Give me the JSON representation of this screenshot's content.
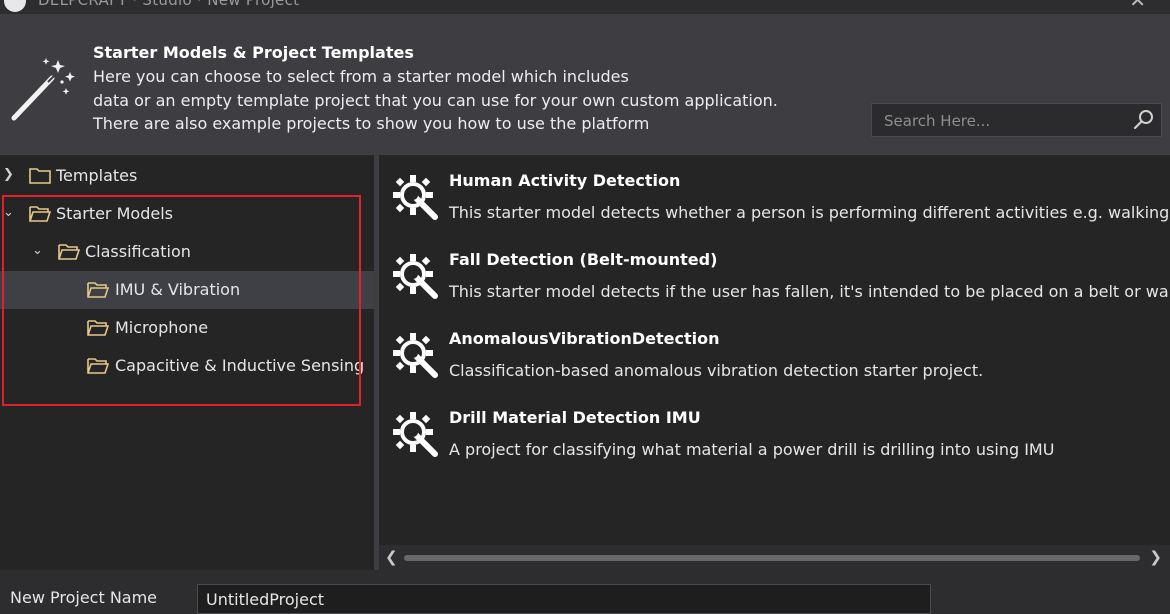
{
  "window": {
    "title": "DELPCRAFT · Studio · New Project",
    "close_glyph": "✕"
  },
  "header": {
    "title": "Starter Models & Project Templates",
    "lines": [
      "Here you can choose to select from a starter model which includes",
      "data or an empty template project that you can use for your own custom application.",
      "There are also example projects to show you how to use the platform"
    ],
    "icon": "magic-wand-icon"
  },
  "search": {
    "placeholder": "Search Here...",
    "value": ""
  },
  "tree": {
    "items": [
      {
        "label": "Templates",
        "level": 0,
        "expanded": false,
        "selected": false
      },
      {
        "label": "Starter Models",
        "level": 0,
        "expanded": true,
        "selected": false
      },
      {
        "label": "Classification",
        "level": 1,
        "expanded": true,
        "selected": false
      },
      {
        "label": "IMU & Vibration",
        "level": 2,
        "expanded": false,
        "selected": true
      },
      {
        "label": "Microphone",
        "level": 2,
        "expanded": false,
        "selected": false
      },
      {
        "label": "Capacitive & Inductive Sensing",
        "level": 2,
        "expanded": false,
        "selected": false
      }
    ]
  },
  "projects": [
    {
      "title": "Human Activity Detection",
      "description": "This starter model detects whether a person is performing different activities e.g. walking",
      "icon": "gear-wrench-icon"
    },
    {
      "title": "Fall Detection (Belt-mounted)",
      "description": "This starter model detects if the user has fallen, it's intended to be placed on a belt or waist",
      "icon": "gear-wrench-icon"
    },
    {
      "title": "AnomalousVibrationDetection",
      "description": "Classification-based anomalous vibration detection starter project.",
      "icon": "gear-wrench-icon"
    },
    {
      "title": "Drill Material Detection IMU",
      "description": "A project for classifying what material a power drill is drilling into using IMU",
      "icon": "gear-wrench-icon"
    }
  ],
  "bottom": {
    "name_label": "New Project Name",
    "name_value": "UntitledProject"
  },
  "colors": {
    "background": "#2d2d30",
    "panel": "#252526",
    "header": "#3e3e42",
    "selected_row": "#3f3f46",
    "highlight_border": "#e0202a"
  }
}
